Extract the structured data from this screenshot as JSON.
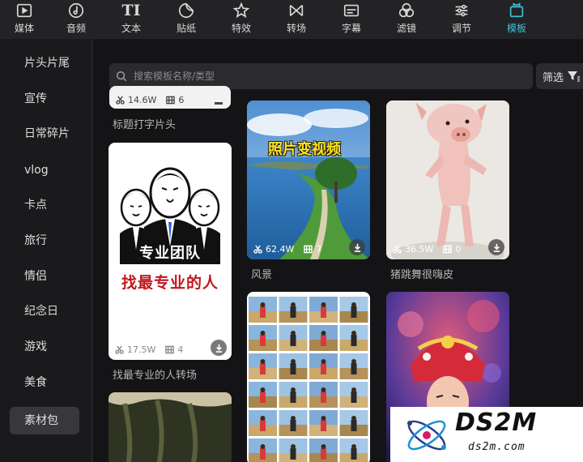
{
  "toolbar": {
    "items": [
      {
        "label": "媒体",
        "icon": "media-icon"
      },
      {
        "label": "音频",
        "icon": "audio-icon"
      },
      {
        "label": "文本",
        "icon": "text-icon",
        "glyph": "TI"
      },
      {
        "label": "贴纸",
        "icon": "sticker-icon"
      },
      {
        "label": "特效",
        "icon": "effects-icon"
      },
      {
        "label": "转场",
        "icon": "transition-icon"
      },
      {
        "label": "字幕",
        "icon": "subtitle-icon"
      },
      {
        "label": "滤镜",
        "icon": "filter-icon"
      },
      {
        "label": "调节",
        "icon": "adjust-icon"
      },
      {
        "label": "模板",
        "icon": "template-icon",
        "active": true
      }
    ],
    "accent_color": "#3cc4d8"
  },
  "sidebar": {
    "items": [
      "片头片尾",
      "宣传",
      "日常碎片",
      "vlog",
      "卡点",
      "旅行",
      "情侣",
      "纪念日",
      "游戏",
      "美食",
      "素材包"
    ],
    "selected": "素材包"
  },
  "search": {
    "placeholder": "搜索模板名称/类型"
  },
  "filter": {
    "label": "筛选"
  },
  "templates": {
    "top_left_partial": {
      "uses": "14.6W",
      "clips": "6",
      "caption": "标题打字片头"
    },
    "team": {
      "uses": "17.5W",
      "clips": "4",
      "caption": "找最专业的人转场",
      "banner": "专业团队",
      "slogan": "找最专业的人"
    },
    "scenery": {
      "uses": "62.4W",
      "clips": "7",
      "caption": "风景",
      "overlay": "照片变视频"
    },
    "pig": {
      "uses": "36.5W",
      "clips": "0",
      "caption": "猪跳舞很嗨皮"
    }
  },
  "watermark": {
    "title": "DS2M",
    "url": "ds2m.com"
  }
}
